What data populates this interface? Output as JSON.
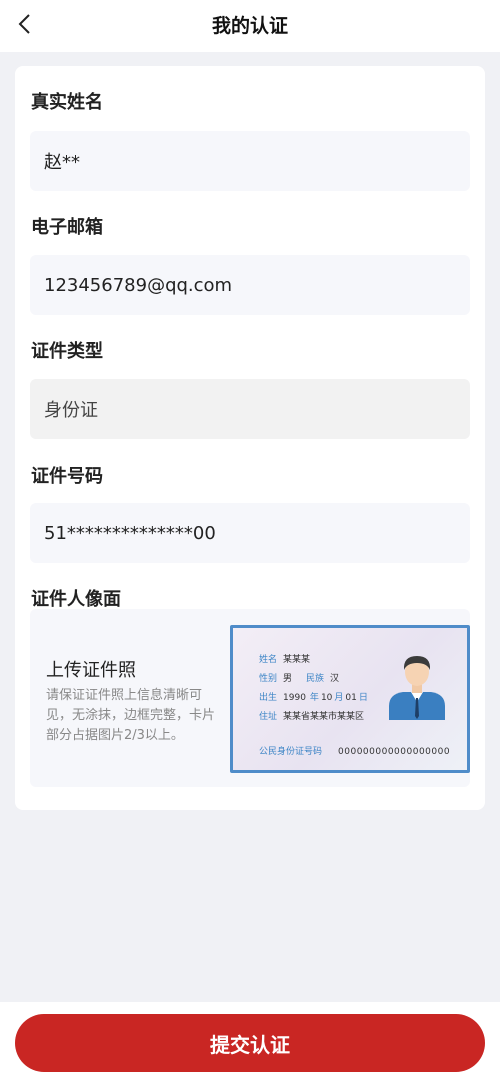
{
  "header": {
    "title": "我的认证",
    "back_icon": "chevron-left-icon"
  },
  "form": {
    "real_name": {
      "label": "真实姓名",
      "value": "赵**"
    },
    "email": {
      "label": "电子邮箱",
      "value": "123456789@qq.com"
    },
    "id_type": {
      "label": "证件类型",
      "value": "身份证"
    },
    "id_number": {
      "label": "证件号码",
      "value": "51**************00"
    },
    "id_photo": {
      "label": "证件人像面",
      "upload_title": "上传证件照",
      "upload_hint": "请保证证件照上信息清晰可见，无涂抹，边框完整，卡片部分占据图片2/3以上。"
    }
  },
  "sample_card": {
    "name_key": "姓名",
    "name_val": "某某某",
    "gender_key": "性别",
    "gender_val": "男",
    "ethnicity_key": "民族",
    "ethnicity_val": "汉",
    "birth_key": "出生",
    "birth_year": "1990",
    "year_key": "年",
    "birth_month": "10",
    "month_key": "月",
    "birth_day": "01",
    "day_key": "日",
    "address_key": "住址",
    "address_val": "某某省某某市某某区",
    "number_key": "公民身份证号码",
    "number_val": "000000000000000000"
  },
  "footer": {
    "submit_label": "提交认证"
  },
  "colors": {
    "accent": "#c92623",
    "card_border": "#4f8cc9"
  }
}
